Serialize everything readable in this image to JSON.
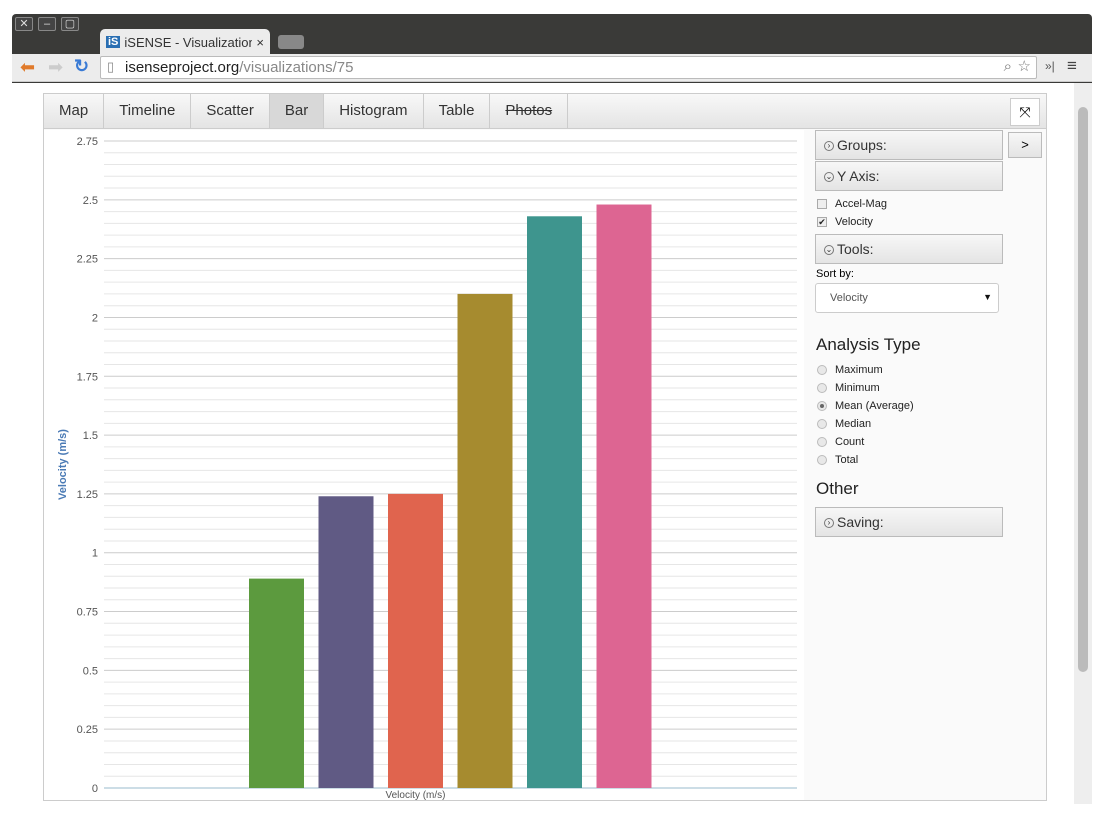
{
  "browser": {
    "tab_title": "iSENSE - Visualization",
    "tab_logo": "iS",
    "url_host": "isenseproject.org",
    "url_path": "/visualizations/75",
    "icons": [
      "back-arrow-icon",
      "forward-arrow-icon",
      "reload-icon",
      "page-icon",
      "zoom-icon",
      "star-icon",
      "menu-icon"
    ]
  },
  "viz_tabs": [
    {
      "label": "Map"
    },
    {
      "label": "Timeline"
    },
    {
      "label": "Scatter"
    },
    {
      "label": "Bar",
      "active": true
    },
    {
      "label": "Histogram"
    },
    {
      "label": "Table"
    },
    {
      "label": "Photos",
      "disabled": true
    }
  ],
  "controls": {
    "groups": "Groups:",
    "y_axis": "Y Axis:",
    "fields": [
      {
        "label": "Accel-Mag",
        "checked": false
      },
      {
        "label": "Velocity",
        "checked": true
      }
    ],
    "tools": "Tools:",
    "sort_by_label": "Sort by:",
    "sort_by_value": "Velocity",
    "analysis_title": "Analysis Type",
    "analysis": [
      {
        "label": "Maximum"
      },
      {
        "label": "Minimum"
      },
      {
        "label": "Mean (Average)",
        "selected": true
      },
      {
        "label": "Median"
      },
      {
        "label": "Count"
      },
      {
        "label": "Total"
      }
    ],
    "other_title": "Other",
    "saving": "Saving:",
    "go": ">"
  },
  "chart_data": {
    "type": "bar",
    "xlabel": "Velocity (m/s)",
    "ylabel": "Velocity (m/s)",
    "ylim": [
      0,
      2.75
    ],
    "yticks": [
      "0",
      "0.25",
      "0.5",
      "0.75",
      "1",
      "1.25",
      "1.5",
      "1.75",
      "2",
      "2.25",
      "2.5",
      "2.75"
    ],
    "grid": true,
    "series": [
      {
        "values": [
          0.89
        ],
        "color": "#5c9a3e"
      },
      {
        "values": [
          1.24
        ],
        "color": "#605a84"
      },
      {
        "values": [
          1.25
        ],
        "color": "#e0644e"
      },
      {
        "values": [
          2.1
        ],
        "color": "#a68b2f"
      },
      {
        "values": [
          2.43
        ],
        "color": "#3e958e"
      },
      {
        "values": [
          2.48
        ],
        "color": "#dd6592"
      }
    ]
  }
}
